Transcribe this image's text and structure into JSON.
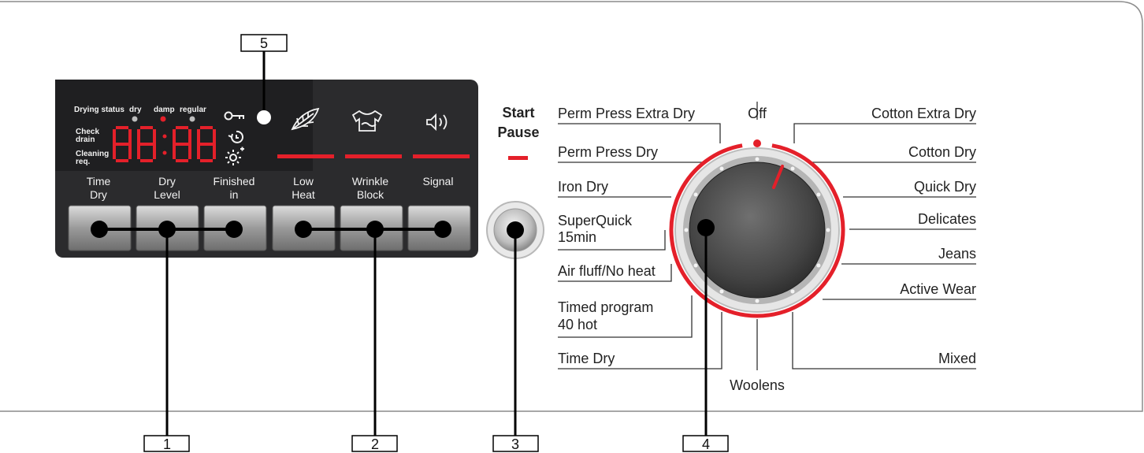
{
  "panel": {
    "display": {
      "drying_status_label": "Drying status",
      "status_levels": [
        "dry",
        "damp",
        "regular"
      ],
      "check_drain_line1": "Check",
      "check_drain_line2": "drain",
      "cleaning_line1": "Cleaning",
      "cleaning_line2": "req.",
      "digits": "88:88"
    },
    "buttons": [
      {
        "line1": "Time",
        "line2": "Dry"
      },
      {
        "line1": "Dry",
        "line2": "Level"
      },
      {
        "line1": "Finished",
        "line2": "in"
      },
      {
        "line1": "Low",
        "line2": "Heat"
      },
      {
        "line1": "Wrinkle",
        "line2": "Block"
      },
      {
        "line1": "Signal",
        "line2": ""
      }
    ],
    "icons": [
      "key-icon",
      "timer-icon",
      "brightness-icon",
      "feather-icon",
      "shirt-icon",
      "speaker-icon"
    ]
  },
  "start_pause": {
    "line1": "Start",
    "line2": "Pause"
  },
  "dial": {
    "off_label": "Off",
    "left_programs": [
      "Perm Press Extra Dry",
      "Perm Press Dry",
      "Iron Dry",
      "SuperQuick",
      "15min",
      "Air fluff/No heat",
      "Timed program",
      "40 hot",
      "Time Dry"
    ],
    "bottom_program": "Woolens",
    "right_programs": [
      "Cotton Extra Dry",
      "Cotton Dry",
      "Quick Dry",
      "Delicates",
      "Jeans",
      "Active Wear",
      "Mixed"
    ]
  },
  "callouts": [
    "1",
    "2",
    "3",
    "4",
    "5"
  ],
  "colors": {
    "accent_red": "#e4202a",
    "panel_bg": "#2b2b2d",
    "display_bg": "#1f1f21"
  }
}
